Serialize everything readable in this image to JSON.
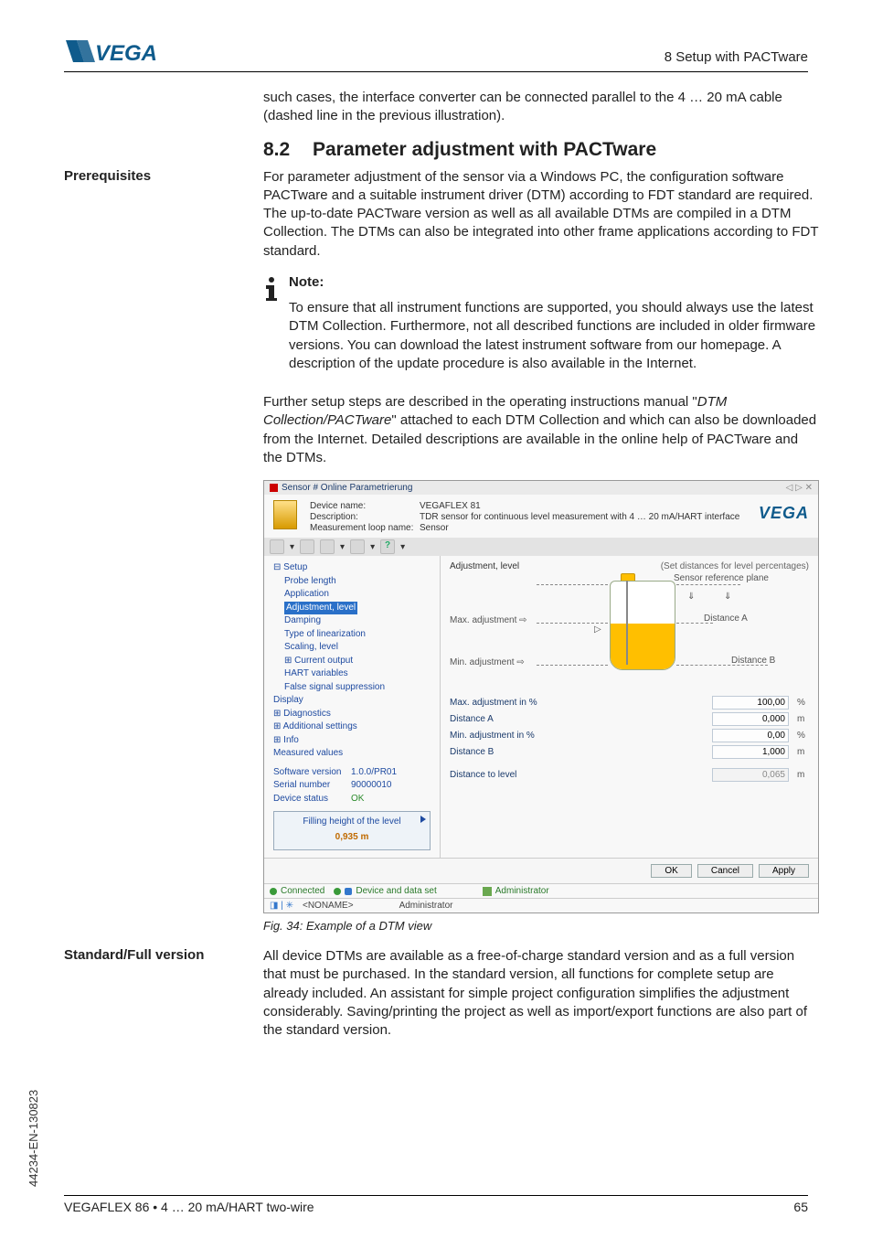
{
  "header": {
    "breadcrumb": "8 Setup with PACTware"
  },
  "intro_para": "such cases, the interface converter can be connected parallel to the 4 … 20 mA cable (dashed line in the previous illustration).",
  "section": {
    "number": "8.2",
    "title": "Parameter adjustment with PACTware"
  },
  "prereq": {
    "sidebar": "Prerequisites",
    "body": "For parameter adjustment of the sensor via a Windows PC, the configuration software PACTware and a suitable instrument driver (DTM) according to FDT standard are required. The up-to-date PACTware version as well as all available DTMs are compiled in a DTM Collection. The DTMs can also be integrated into other frame applications according to FDT standard."
  },
  "note": {
    "title": "Note:",
    "body": "To ensure that all instrument functions are supported, you should always use the latest DTM Collection. Furthermore, not all described functions are included in older firmware versions. You can download the latest instrument software from our homepage. A description of the update procedure is also available in the Internet."
  },
  "further": "Further setup steps are described in the operating instructions manual \"DTM Collection/PACTware\" attached to each DTM Collection and which can also be downloaded from the Internet. Detailed descriptions are available in the online help of PACTware and the DTMs.",
  "screenshot": {
    "title": "Sensor # Online Parametrierung",
    "device_name_label": "Device name:",
    "device_name": "VEGAFLEX 81",
    "description_label": "Description:",
    "description": "TDR sensor for continuous level measurement with 4 … 20 mA/HART interface",
    "loop_label": "Measurement loop name:",
    "loop": "Sensor",
    "brand": "VEGA",
    "tree": {
      "setup": "Setup",
      "items": [
        "Probe length",
        "Application",
        "Adjustment, level",
        "Damping",
        "Type of linearization",
        "Scaling, level",
        "Current output",
        "HART variables",
        "False signal suppression"
      ],
      "display": "Display",
      "diagnostics": "Diagnostics",
      "additional": "Additional settings",
      "info": "Info",
      "measured": "Measured values",
      "sw_label": "Software version",
      "sw": "1.0.0/PR01",
      "sn_label": "Serial number",
      "sn": "90000010",
      "status_label": "Device status",
      "status": "OK",
      "fill_label": "Filling height of the level",
      "fill_value": "0,935 m"
    },
    "panel": {
      "title": "Adjustment, level",
      "right_title": "(Set distances for level percentages)",
      "ref_plane": "Sensor reference plane",
      "max_adj_lbl": "Max. adjustment",
      "min_adj_lbl": "Min. adjustment",
      "distA": "Distance A",
      "distB": "Distance B",
      "fields": [
        {
          "label": "Max. adjustment in %",
          "value": "100,00",
          "unit": "%"
        },
        {
          "label": "Distance A",
          "value": "0,000",
          "unit": "m"
        },
        {
          "label": "Min. adjustment in %",
          "value": "0,00",
          "unit": "%"
        },
        {
          "label": "Distance B",
          "value": "1,000",
          "unit": "m"
        }
      ],
      "dist_level_label": "Distance to level",
      "dist_level_value": "0,065",
      "dist_level_unit": "m",
      "ok": "OK",
      "cancel": "Cancel",
      "apply": "Apply"
    },
    "status": {
      "connected": "Connected",
      "dataset": "Device and data set",
      "admin": "Administrator",
      "noname": "<NONAME>",
      "admin2": "Administrator"
    }
  },
  "fig_caption": "Fig. 34: Example of a DTM view",
  "standard": {
    "sidebar": "Standard/Full version",
    "body": "All device DTMs are available as a free-of-charge standard version and as a full version that must be purchased. In the standard version, all functions for complete setup are already included. An assistant for simple project configuration simplifies the adjustment considerably. Saving/printing the project as well as import/export functions are also part of the standard version."
  },
  "rotated": "44234-EN-130823",
  "footer": {
    "left": "VEGAFLEX 86 • 4 … 20 mA/HART two-wire",
    "right": "65"
  }
}
